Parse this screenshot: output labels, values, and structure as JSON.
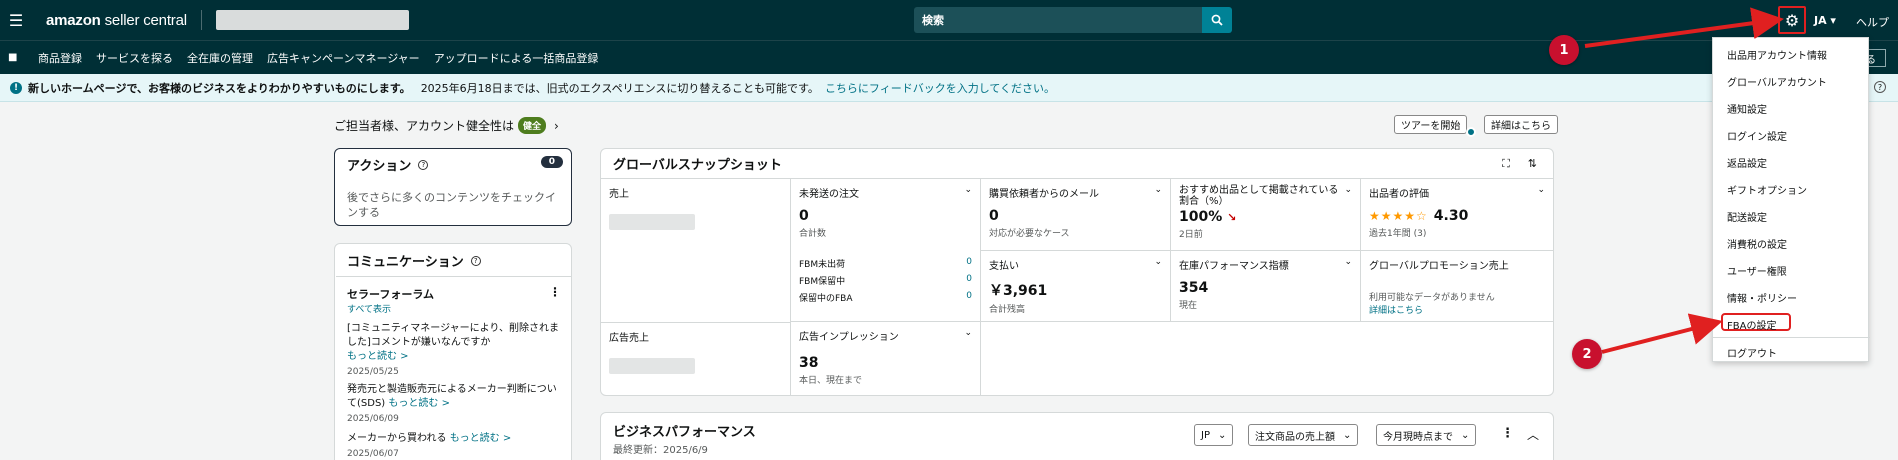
{
  "topbar": {
    "logo_brand": "amazon",
    "logo_product": "seller central",
    "search_placeholder": "検索",
    "language": "JA ▾",
    "help": "ヘルプ"
  },
  "nav": {
    "items": [
      "商品登録",
      "サービスを探る",
      "全在庫の管理",
      "広告キャンペーンマネージャー",
      "アップロードによる一括商品登録"
    ],
    "right_button": "る"
  },
  "notice": {
    "bold_text": "新しいホームページで、お客様のビジネスをよりわかりやすいものにします。",
    "text": "2025年6月18日までは、旧式のエクスペリエンスに切り替えることも可能です。",
    "link": "こちらにフィードバックを入力してください。"
  },
  "health": {
    "text": "ご担当者様、アカウント健全性は",
    "badge": "健全"
  },
  "buttons": {
    "tour": "ツアーを開始",
    "details": "詳細はこちら"
  },
  "action_card": {
    "title": "アクション",
    "count": "0",
    "body": "後でさらに多くのコンテンツをチェックインする"
  },
  "comm_card": {
    "title": "コミュニケーション",
    "forum_title": "セラーフォーラム",
    "view_all": "すべて表示",
    "items": [
      {
        "text": "[コミュニティマネージャーにより、削除されました]コメントが嫌いなんですか",
        "more": "もっと読む >",
        "date": "2025/05/25"
      },
      {
        "text": "発売元と製造販売元によるメーカー判断について(SDS)",
        "more": "もっと読む >",
        "date": "2025/06/09"
      },
      {
        "text": "メーカーから買われる",
        "more": "もっと読む >",
        "date": "2025/06/07"
      }
    ]
  },
  "snapshot": {
    "title": "グローバルスナップショット",
    "sales": {
      "label": "売上"
    },
    "unshipped": {
      "label": "未発送の注文",
      "value": "0",
      "sub": "合計数",
      "rows": [
        {
          "k": "FBM未出荷",
          "v": "0"
        },
        {
          "k": "FBM保留中",
          "v": "0"
        },
        {
          "k": "保留中のFBA",
          "v": "0"
        }
      ]
    },
    "buyer_msg": {
      "label": "購買依頼者からのメール",
      "value": "0",
      "sub": "対応が必要なケース"
    },
    "featured": {
      "label": "おすすめ出品として掲載されている割合（%）",
      "value": "100%",
      "sub": "2日前"
    },
    "seller_rating": {
      "label": "出品者の評価",
      "stars": "★★★★☆",
      "value": "4.30",
      "sub": "過去1年間 (3)"
    },
    "payments": {
      "label": "支払い",
      "value": "￥3,961",
      "sub": "合計残高"
    },
    "inventory": {
      "label": "在庫パフォーマンス指標",
      "value": "354",
      "sub": "現在"
    },
    "promotion": {
      "label": "グローバルプロモーション売上",
      "sub": "利用可能なデータがありません",
      "link": "詳細はこちら"
    },
    "ad_sales": {
      "label": "広告売上"
    },
    "ad_impressions": {
      "label": "広告インプレッション",
      "value": "38",
      "sub": "本日、現在まで"
    }
  },
  "business": {
    "title": "ビジネスパフォーマンス",
    "updated": "最終更新：2025/6/9",
    "selects": [
      "JP",
      "注文商品の売上額",
      "今月現時点まで"
    ]
  },
  "menu": {
    "items": [
      "出品用アカウント情報",
      "グローバルアカウント",
      "通知設定",
      "ログイン設定",
      "返品設定",
      "ギフトオプション",
      "配送設定",
      "消費税の設定",
      "ユーザー権限",
      "情報・ポリシー",
      "FBAの設定",
      "ログアウト"
    ]
  },
  "annotations": {
    "step1": "1",
    "step2": "2"
  },
  "colors": {
    "topbar": "#002f36",
    "link": "#007185",
    "highlight": "#e02020",
    "marker": "#c8102e"
  }
}
